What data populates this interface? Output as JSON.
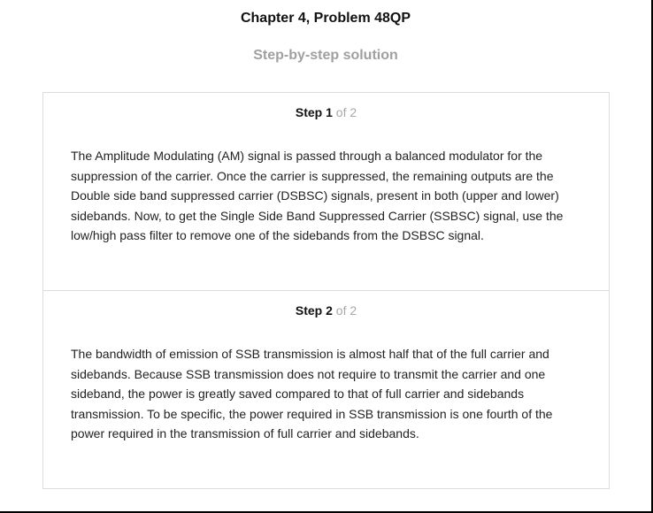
{
  "header": {
    "title": "Chapter 4, Problem 48QP",
    "subtitle": "Step-by-step solution"
  },
  "steps": [
    {
      "word": "Step",
      "number": "1",
      "of": "of 2",
      "text": "The Amplitude Modulating (AM) signal is passed through a balanced modulator for the suppression of the carrier. Once the carrier is suppressed, the remaining outputs are the Double side band suppressed carrier (DSBSC) signals, present in both (upper and lower) sidebands. Now, to get the Single Side Band Suppressed Carrier (SSBSC) signal, use the low/high pass filter to remove one of the sidebands from the DSBSC signal."
    },
    {
      "word": "Step",
      "number": "2",
      "of": "of 2",
      "text": "The bandwidth of emission of SSB transmission is almost half that of the full carrier and sidebands. Because SSB transmission does not require to transmit the carrier and one sideband, the power is greatly saved compared to that of full carrier and sidebands transmission. To be specific, the power required in SSB transmission is one fourth of the power required in the transmission of full carrier and sidebands."
    }
  ]
}
